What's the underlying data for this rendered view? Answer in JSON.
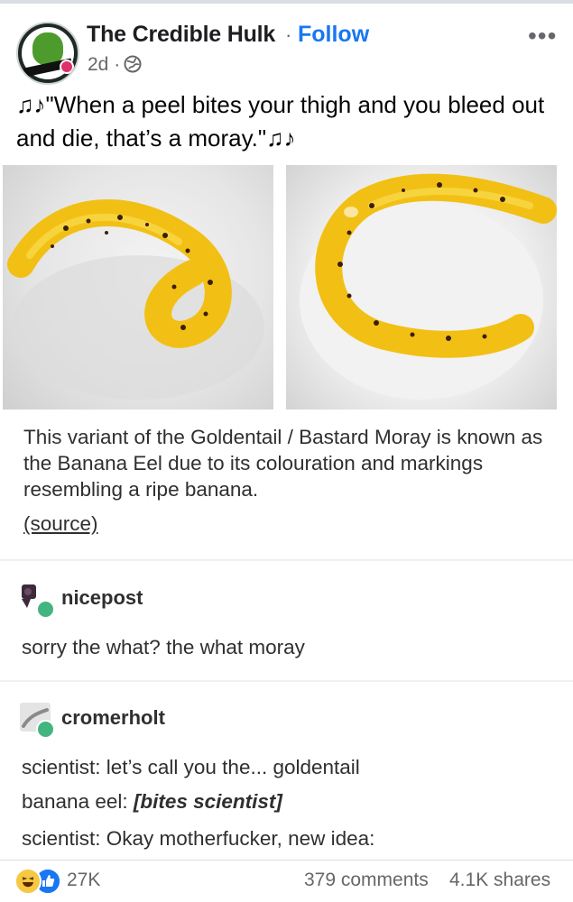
{
  "post": {
    "page_name": "The Credible Hulk",
    "separator": "·",
    "follow_label": "Follow",
    "more_label": "•••",
    "time": "2d ·",
    "text": "♫♪\"When a peel bites your thigh and you bleed out and die, that’s a moray.\"♫♪"
  },
  "tumblr": {
    "caption": "This variant of the Goldentail / Bastard Moray is known as the Banana Eel due to its colouration and markings resembling a ripe banana.",
    "source_label": "(source)",
    "replies": [
      {
        "username": "nicepost",
        "lines": [
          "sorry the what? the what moray"
        ]
      },
      {
        "username": "cromerholt",
        "lines": [
          "scientist: let’s call you the... goldentail",
          "banana eel: ",
          "scientist: Okay motherfucker, new idea:"
        ],
        "emphasis": "[bites scientist]"
      }
    ]
  },
  "footer": {
    "reactions": "27K",
    "comments": "379 comments",
    "shares": "4.1K shares"
  },
  "icons": {
    "avatar": "hulk-avatar-icon",
    "globe": "globe-icon",
    "reactions": [
      "haha-reaction-icon",
      "like-reaction-icon"
    ]
  },
  "colors": {
    "brand_blue": "#1877f2",
    "text": "#1c1e21",
    "meta": "#65676b",
    "eel_yellow": "#f2c014"
  }
}
